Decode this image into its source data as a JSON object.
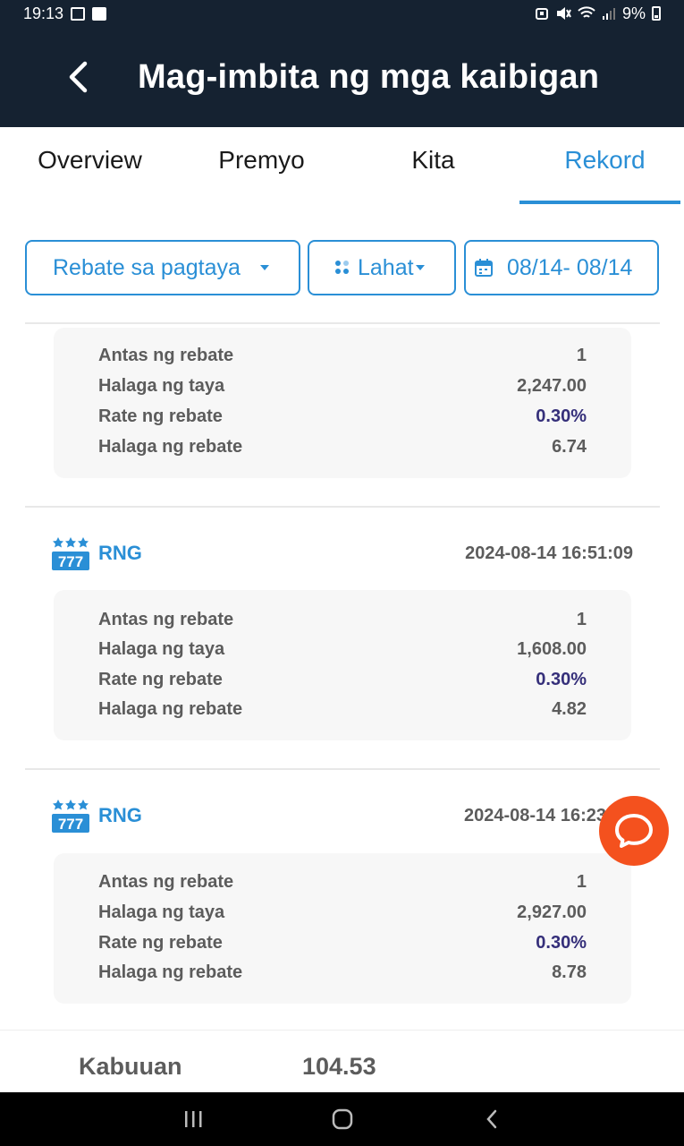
{
  "status_bar": {
    "time": "19:13",
    "battery": "9%",
    "icons": [
      "image-icon",
      "check-box-icon",
      "alarm-icon",
      "mute-icon",
      "wifi-icon",
      "signal-icon",
      "battery-icon"
    ]
  },
  "header": {
    "title": "Mag-imbita ng mga kaibigan",
    "back_icon": "chevron-left-icon"
  },
  "tabs": [
    {
      "label": "Overview",
      "active": false
    },
    {
      "label": "Premyo",
      "active": false
    },
    {
      "label": "Kita",
      "active": false
    },
    {
      "label": "Rekord",
      "active": true
    }
  ],
  "filters": {
    "type": "Rebate sa pagtaya",
    "category": "Lahat",
    "date_range": "08/14- 08/14"
  },
  "records": [
    {
      "game": "",
      "time": "",
      "rows": [
        {
          "label": "Antas ng rebate",
          "value": "1"
        },
        {
          "label": "Halaga ng taya",
          "value": "2,247.00"
        },
        {
          "label": "Rate ng rebate",
          "value": "0.30%"
        },
        {
          "label": "Halaga ng rebate",
          "value": "6.74"
        }
      ]
    },
    {
      "game": "RNG",
      "time": "2024-08-14 16:51:09",
      "rows": [
        {
          "label": "Antas ng rebate",
          "value": "1"
        },
        {
          "label": "Halaga ng taya",
          "value": "1,608.00"
        },
        {
          "label": "Rate ng rebate",
          "value": "0.30%"
        },
        {
          "label": "Halaga ng rebate",
          "value": "4.82"
        }
      ]
    },
    {
      "game": "RNG",
      "time": "2024-08-14 16:23",
      "rows": [
        {
          "label": "Antas ng rebate",
          "value": "1"
        },
        {
          "label": "Halaga ng taya",
          "value": "2,927.00"
        },
        {
          "label": "Rate ng rebate",
          "value": "0.30%"
        },
        {
          "label": "Halaga ng rebate",
          "value": "8.78"
        }
      ]
    }
  ],
  "footer": {
    "label": "Kabuuan",
    "value": "104.53"
  },
  "colors": {
    "header_bg": "#152231",
    "accent": "#2a8fd6",
    "rate": "#352f7a",
    "chat_fab": "#f4511e"
  }
}
